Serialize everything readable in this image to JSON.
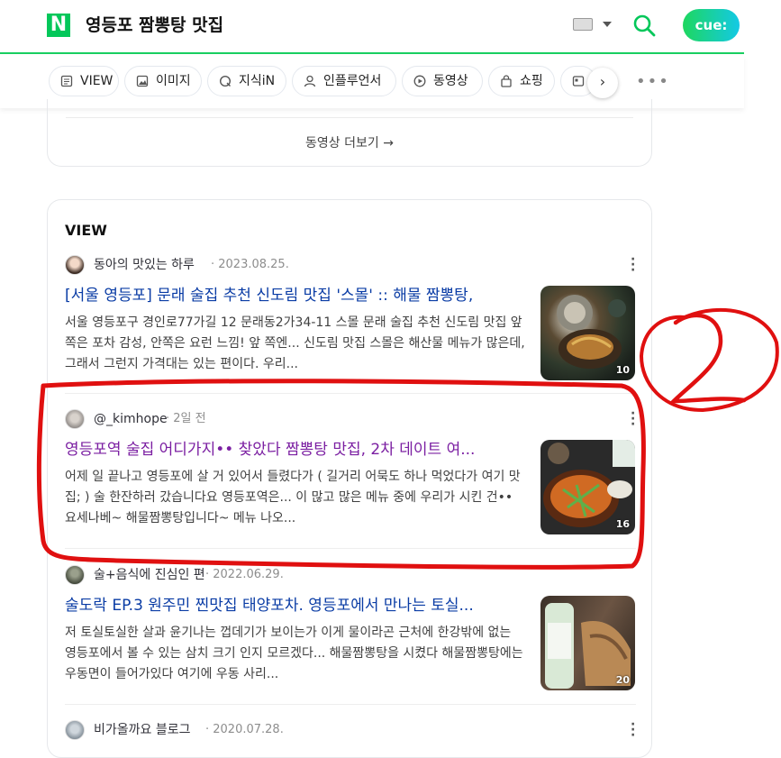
{
  "header": {
    "logo": "N",
    "query": "영등포 짬뽕탕 맛집",
    "cue_label": "cue:"
  },
  "tabs": [
    {
      "label": "VIEW",
      "icon": "document-icon"
    },
    {
      "label": "이미지",
      "icon": "image-icon"
    },
    {
      "label": "지식iN",
      "icon": "q-icon"
    },
    {
      "label": "인플루언서",
      "icon": "person-icon"
    },
    {
      "label": "동영상",
      "icon": "play-icon"
    },
    {
      "label": "쇼핑",
      "icon": "shopping-bag-icon"
    },
    {
      "label": "",
      "icon": "news-icon"
    }
  ],
  "more_video": "동영상 더보기 →",
  "view": {
    "section_title": "VIEW",
    "posts": [
      {
        "author": "동아의 맛있는 하루",
        "date": "· 2023.08.25.",
        "title": "[서울 영등포] 문래 술집 추천 신도림 맛집 '스몰' :: 해물 짬뽕탕,",
        "desc": "서울 영등포구 경인로77가길 12 문래동2가34-11 스몰 문래 술집 추천 신도림 맛집 앞 쪽은 포차 감성, 안쪽은 요런 느낌! 앞 쪽엔... 신도림 맛집 스몰은 해산물 메뉴가 많은데, 그래서 그런지 가격대는 있는 편이다. 우리...",
        "thumb_count": "10",
        "visited": false
      },
      {
        "author": "@_kimhope",
        "date": "· 2일 전",
        "title": "영등포역 술집 어디가지•• 찾았다 짬뽕탕 맛집, 2차 데이트 여...",
        "desc": "어제 일 끝나고 영등포에 살 거 있어서 들렸다가 ( 길거리 어묵도 하나 먹었다가 여기 맛집; ) 술 한잔하러 갔습니다요 영등포역은... 이 많고 많은 메뉴 중에 우리가 시킨 건•• 요세나베~ 해물짬뽕탕입니다~ 메뉴 나오...",
        "thumb_count": "16",
        "visited": true
      },
      {
        "author": "술+음식에 진심인 편",
        "date": "· 2022.06.29.",
        "title": "술도락 EP.3 원주민 찐맛집 태양포차. 영등포에서 만나는 토실...",
        "desc": "저 토실토실한 살과 윤기나는 껍데기가 보이는가 이게 물이라곤 근처에 한강밖에 없는 영등포에서 볼 수 있는 삼치 크기 인지 모르겠다... 해물짬뽕탕을 시켰다 해물짬뽕탕에는 우동면이 들어가있다 여기에 우동 사리...",
        "thumb_count": "20",
        "visited": false
      },
      {
        "author": "비가올까요 블로그",
        "date": "· 2020.07.28."
      }
    ]
  },
  "annotation": {
    "label": "2",
    "color": "#e01010"
  }
}
